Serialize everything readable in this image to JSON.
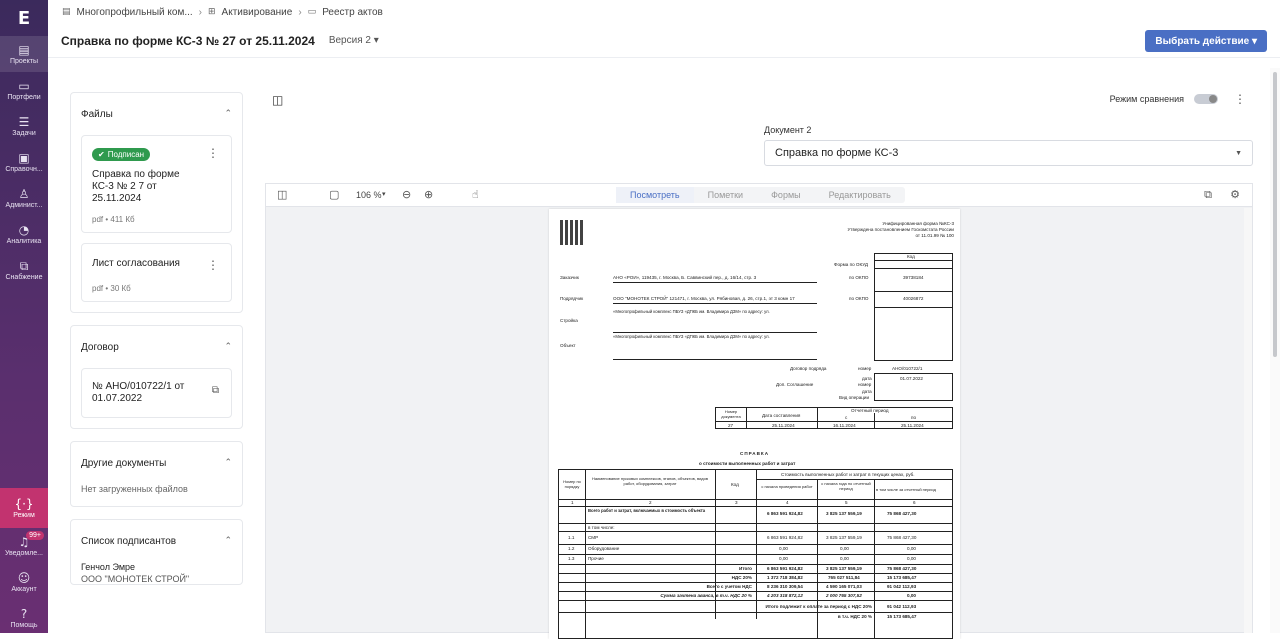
{
  "nav": {
    "logo": "E",
    "items": [
      {
        "label": "Проекты",
        "icon": "building-icon"
      },
      {
        "label": "Портфели",
        "icon": "briefcase-icon"
      },
      {
        "label": "Задачи",
        "icon": "tasks-icon"
      },
      {
        "label": "Справочн...",
        "icon": "book-icon"
      },
      {
        "label": "Админист...",
        "icon": "admin-icon"
      },
      {
        "label": "Аналитика",
        "icon": "chart-icon"
      },
      {
        "label": "Снабжение",
        "icon": "supply-icon"
      }
    ],
    "mode": {
      "label": "Режим",
      "icon": "code-icon"
    },
    "notifications": {
      "label": "Уведомле...",
      "badge": "99+"
    },
    "account": {
      "label": "Аккаунт"
    },
    "help": {
      "label": "Помощь"
    }
  },
  "breadcrumb": {
    "items": [
      "Многопрофильный ком...",
      "Активирование",
      "Реестр актов"
    ]
  },
  "header": {
    "title": "Справка по форме КС-3 № 27 от 25.11.2024",
    "version": "Версия 2",
    "action_button": "Выбрать действие"
  },
  "sidebar": {
    "files": {
      "title": "Файлы",
      "items": [
        {
          "status": "Подписан",
          "name": "Справка по форме КС-3 № 2 7 от 25.11.2024",
          "meta": "pdf • 411 Кб"
        },
        {
          "name": "Лист согласования",
          "meta": "pdf • 30 Кб"
        }
      ]
    },
    "contract": {
      "title": "Договор",
      "number": "№ АНО/010722/1 от 01.07.2022"
    },
    "other_docs": {
      "title": "Другие документы",
      "empty": "Нет загруженных файлов"
    },
    "signers": {
      "title": "Список подписантов",
      "name": "Генчол Эмре",
      "org": "ООО \"МОНОТЕК СТРОЙ\""
    }
  },
  "compare": {
    "label": "Режим сравнения"
  },
  "document2": {
    "label": "Документ 2",
    "value": "Справка по форме КС-3"
  },
  "viewer": {
    "zoom": "106 %",
    "tabs": [
      "Посмотреть",
      "Пометки",
      "Формы",
      "Редактировать"
    ]
  },
  "pdf": {
    "header_right": [
      "Унифицированная форма №КС-3",
      "Утверждена постановлением Госкомстата России",
      "от 11.01.99 № 100"
    ],
    "kod": "Код",
    "okud": "Форма по ОКУД",
    "zakazchik_label": "Заказчик",
    "zakazchik": "АНО «РОИ», 119435, г. Москва, Б. Саввинский пер., д. 16/14, стр. 3",
    "okpo": "по ОКПО",
    "okpo1": "39738184",
    "podryadchik_label": "Подрядчик",
    "podryadchik": "ООО \"МОНОТЕК СТРОЙ\" 121471, г. Москва, ул. Рябиновая, д. 26, стр.1, эт 3 комн 17",
    "okpo2": "40026872",
    "stroyka_label": "Стройка",
    "stroyka": "«Многопрофильный комплекс ПБУЗ «ДПКБ им. Владимира ДЗМ» по адресу: ул.",
    "objekt_label": "Объект",
    "dogovor_label": "Договор подряда",
    "nomer": "номер",
    "dogovor_num": "АНО/010722/1",
    "data": "дата",
    "dogovor_date": "01.07.2022",
    "dop": "Доп. Соглашение",
    "vid": "Вид операции",
    "nomer_doc": "Номер документа",
    "data_sost": "Дата составления",
    "otchet": "Отчетный период",
    "s": "с",
    "po": "по",
    "doc_num": "27",
    "doc_date": "25.11.2024",
    "period_from": "16.11.2024",
    "period_to": "25.11.2024",
    "spravka_title": "СПРАВКА",
    "spravka_sub": "о стоимости выполненных работ и затрат",
    "columns": [
      "Номер по порядку",
      "Наименование пусковых комплексов, этапов, объектов, видов работ, оборудования, затрат",
      "Код",
      "с начала проведения работ",
      "с начала года по отчетный период",
      "в том числе за отчетный период"
    ],
    "col_header_stoimost": "Стоимость выполненных работ и затрат в текущих ценах, руб.",
    "col_nums": [
      "1",
      "2",
      "3",
      "4",
      "5",
      "6"
    ],
    "rows": [
      {
        "n": "",
        "name": "Всего работ и затрат, включаемых в стоимость объекта",
        "c4": "6 863 591 924,82",
        "c5": "3 825 137 559,19",
        "c6": "75 868 427,30"
      },
      {
        "n": "",
        "name": "в том числе:",
        "c4": "",
        "c5": "",
        "c6": ""
      },
      {
        "n": "1.1",
        "name": "СМР",
        "c4": "6 863 591 924,82",
        "c5": "3 825 137 559,19",
        "c6": "75 868 427,30"
      },
      {
        "n": "1.2",
        "name": "Оборудование",
        "c4": "0,00",
        "c5": "0,00",
        "c6": "0,00"
      },
      {
        "n": "1.3",
        "name": "Прочие",
        "c4": "0,00",
        "c5": "0,00",
        "c6": "0,00"
      }
    ],
    "totals": [
      {
        "label": "Итого",
        "c4": "6 863 591 924,82",
        "c5": "3 825 137 559,19",
        "c6": "75 868 427,30"
      },
      {
        "label": "НДС 20%",
        "c4": "1 372 718 384,82",
        "c5": "765 027 511,84",
        "c6": "15 173 685,47"
      },
      {
        "label": "Всего с учетом НДС",
        "c4": "8 236 310 309,54",
        "c5": "4 590 165 071,03",
        "c6": "91 042 112,93"
      },
      {
        "label": "Сумма зачтена аванса, в т.ч. НДС 20 %",
        "c4": "4 203 318 872,12",
        "c5": "2 000 765 307,52",
        "c6": "0,00"
      }
    ],
    "itogo_label": "Итого подлежит к оплате за период с НДС 20%",
    "itogo_value": "91 042 112,93",
    "nds_label": "в т.ч. НДС 20 %",
    "nds_value": "15 173 685,47"
  }
}
